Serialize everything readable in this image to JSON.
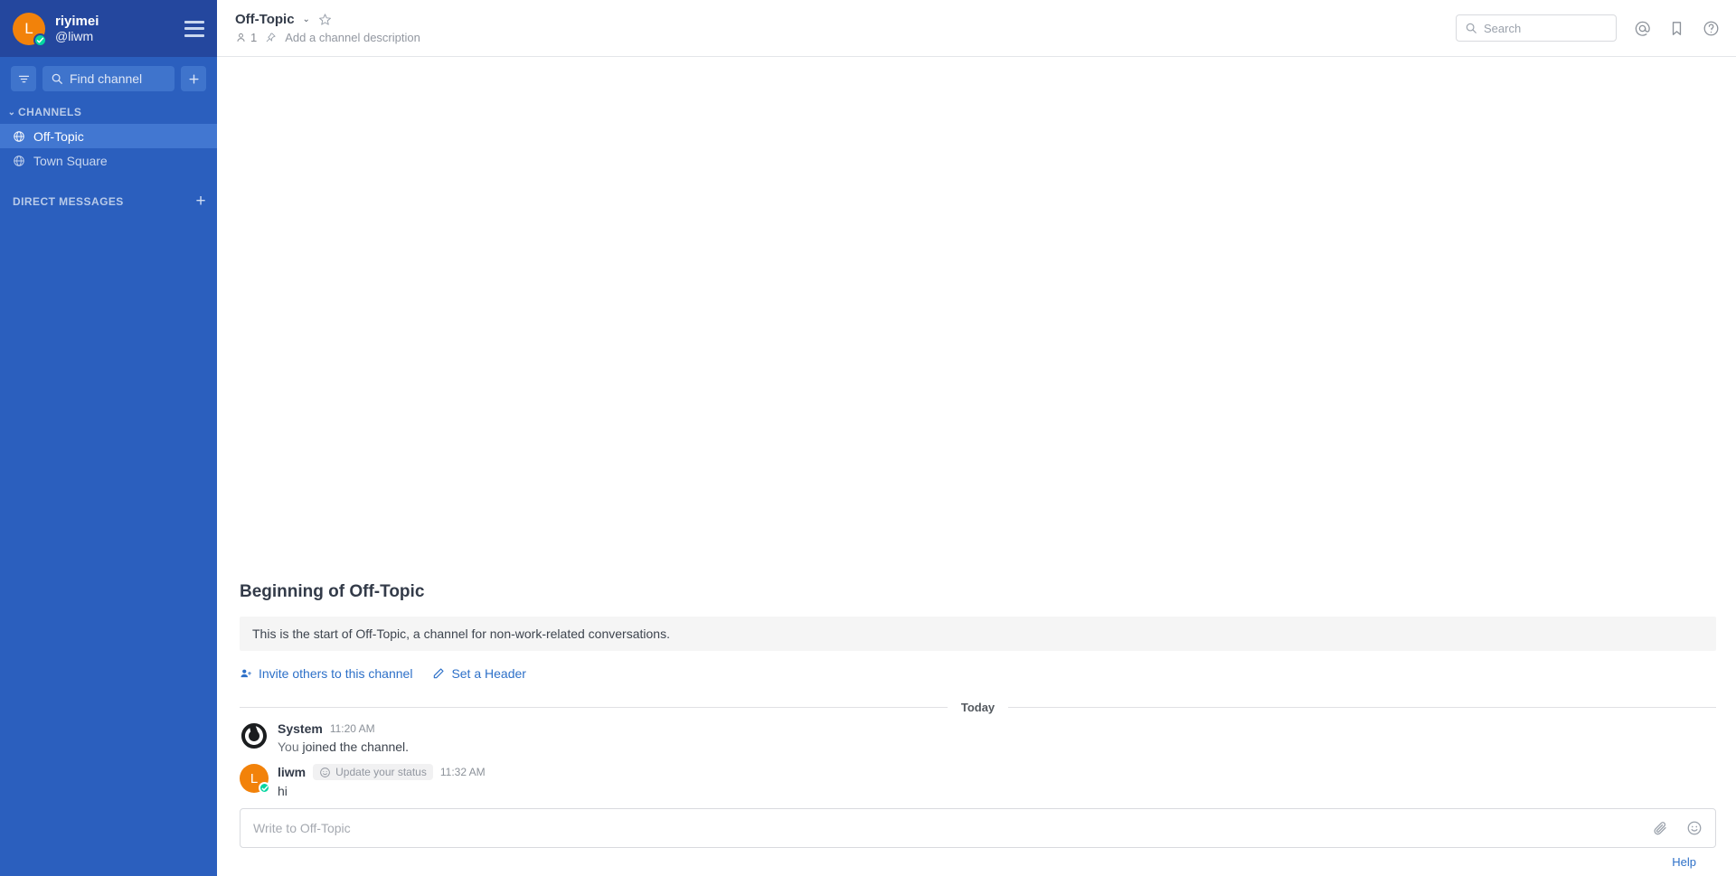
{
  "colors": {
    "sidebar_bg": "#2b5fbe",
    "team_header_bg": "#24479e",
    "sidebar_active": "#4277d1",
    "avatar_orange": "#f2820a",
    "status_green": "#06d6a0",
    "link_blue": "#2d70c8",
    "text_dark": "#333b49"
  },
  "sidebar": {
    "team": {
      "avatar_initial": "L",
      "name": "riyimei",
      "username": "@liwm"
    },
    "tools": {
      "filter_icon": "filter-icon",
      "find_channel_placeholder": "Find channel",
      "add_icon": "plus-icon"
    },
    "categories": [
      {
        "label": "CHANNELS",
        "chevron": "⌄",
        "has_plus": false,
        "channels": [
          {
            "name": "Off-Topic",
            "icon": "globe-icon",
            "active": true
          },
          {
            "name": "Town Square",
            "icon": "globe-icon",
            "active": false
          }
        ]
      },
      {
        "label": "DIRECT MESSAGES",
        "chevron": "",
        "has_plus": true,
        "plus": "+",
        "channels": []
      }
    ]
  },
  "channel_header": {
    "title": "Off-Topic",
    "chevron": "⌄",
    "favorite_icon": "star-icon",
    "member_count": "1",
    "member_icon": "member-icon",
    "pin_icon": "pin-icon",
    "description_placeholder": "Add a channel description",
    "search_placeholder": "Search",
    "search_icon": "search-icon",
    "icons": [
      {
        "name": "at-mention-icon"
      },
      {
        "name": "saved-posts-icon"
      },
      {
        "name": "help-icon"
      }
    ]
  },
  "intro": {
    "title": "Beginning of Off-Topic",
    "description": "This is the start of Off-Topic, a channel for non-work-related conversations.",
    "actions": [
      {
        "label": "Invite others to this channel",
        "icon": "add-user-icon"
      },
      {
        "label": "Set a Header",
        "icon": "pencil-icon"
      }
    ]
  },
  "day_divider": {
    "label": "Today"
  },
  "posts": [
    {
      "author": "System",
      "avatar_type": "system-logo",
      "time": "11:20 AM",
      "text_prefix": "You ",
      "text_bold": "joined the channel.",
      "is_system": true
    },
    {
      "author": "liwm",
      "avatar_type": "initial",
      "avatar_initial": "L",
      "status_pill": "Update your status",
      "status_pill_icon": "emoji-smile-icon",
      "time": "11:32 AM",
      "text": "hi",
      "is_system": false
    }
  ],
  "composer": {
    "placeholder": "Write to Off-Topic",
    "attach_icon": "paperclip-icon",
    "emoji_icon": "emoji-smile-icon"
  },
  "footer": {
    "help_label": "Help"
  }
}
